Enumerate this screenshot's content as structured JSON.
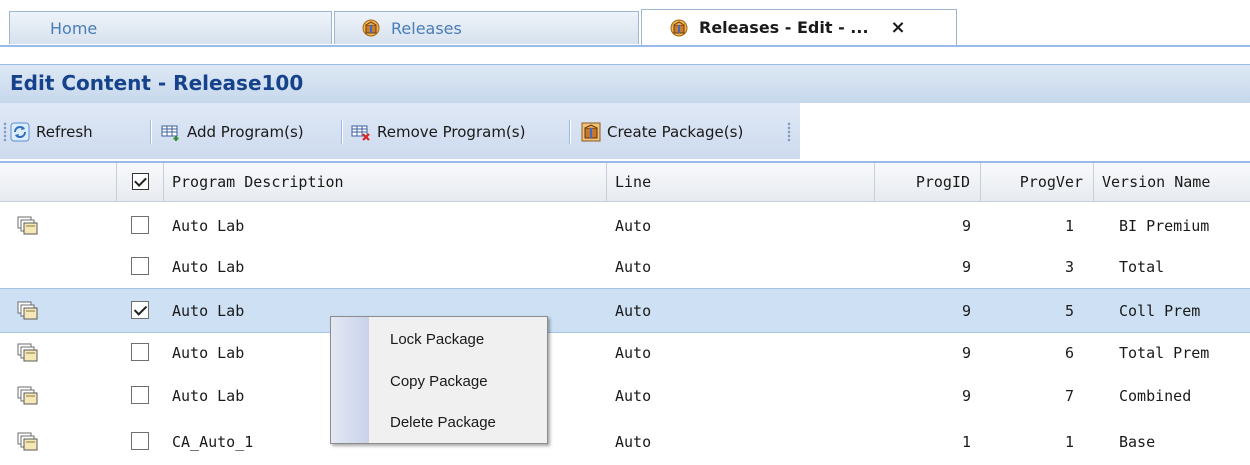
{
  "tabs": [
    {
      "label": "Home",
      "active": false,
      "icon": null
    },
    {
      "label": "Releases",
      "active": false,
      "icon": "release-box-icon"
    },
    {
      "label": "Releases - Edit - ...",
      "active": true,
      "icon": "release-box-icon",
      "close": "×"
    }
  ],
  "panel": {
    "title": "Edit Content - Release100"
  },
  "toolbar": {
    "refresh_label": "Refresh",
    "add_label": "Add Program(s)",
    "remove_label": "Remove Program(s)",
    "create_label": "Create Package(s)"
  },
  "grid": {
    "columns": [
      "",
      "",
      "Program Description",
      "Line",
      "ProgID",
      "ProgVer",
      "Version Name"
    ],
    "rows": [
      {
        "has_package": true,
        "checked": false,
        "selected": false,
        "description": "Auto Lab",
        "line": "Auto",
        "progid": "9",
        "progver": "1",
        "version_name": "BI Premium"
      },
      {
        "has_package": false,
        "checked": false,
        "selected": false,
        "description": "Auto Lab",
        "line": "Auto",
        "progid": "9",
        "progver": "3",
        "version_name": "Total"
      },
      {
        "has_package": true,
        "checked": true,
        "selected": true,
        "description": "Auto Lab",
        "line": "Auto",
        "progid": "9",
        "progver": "5",
        "version_name": "Coll Prem"
      },
      {
        "has_package": true,
        "checked": false,
        "selected": false,
        "description": "Auto Lab",
        "line": "Auto",
        "progid": "9",
        "progver": "6",
        "version_name": "Total Prem"
      },
      {
        "has_package": true,
        "checked": false,
        "selected": false,
        "description": "Auto Lab",
        "line": "Auto",
        "progid": "9",
        "progver": "7",
        "version_name": "Combined"
      },
      {
        "has_package": true,
        "checked": false,
        "selected": false,
        "description": "CA_Auto_1",
        "line": "Auto",
        "progid": "1",
        "progver": "1",
        "version_name": "Base"
      }
    ]
  },
  "context_menu": {
    "items": [
      "Lock Package",
      "Copy Package",
      "Delete Package"
    ]
  },
  "colors": {
    "accent": "#15428b",
    "tab_inactive_text": "#4a7cb8",
    "selected_row": "#cde0f4",
    "border": "#99bbe8"
  }
}
